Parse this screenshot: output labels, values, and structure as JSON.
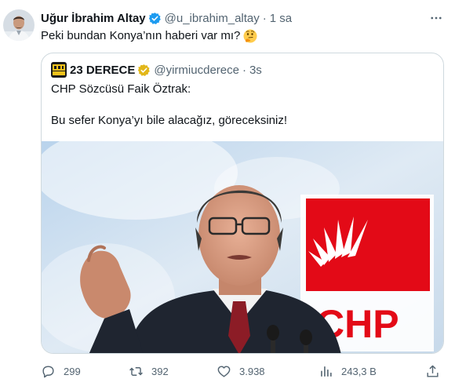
{
  "tweet": {
    "author_name": "Uğur İbrahim Altay",
    "author_handle": "@u_ibrahim_altay",
    "separator": "·",
    "time": "1 sa",
    "text": "Peki bundan Konya’nın haberi var mı?",
    "emoji_icon": "thinking-face-icon"
  },
  "quote": {
    "author_name": "23 DERECE",
    "author_handle": "@yirmiucderece",
    "separator": "·",
    "time": "3s",
    "text_line1": "CHP Sözcüsü Faik Öztrak:",
    "text_line2": "Bu sefer Konya’yı bile alacağız, göreceksiniz!",
    "photo_logo_text": "CHP"
  },
  "actions": {
    "replies": "299",
    "retweets": "392",
    "likes": "3.938",
    "views": "243,3 B"
  },
  "colors": {
    "text_primary": "#0f1419",
    "text_secondary": "#536471",
    "verified_blue": "#1d9bf0",
    "verified_gold": "#e2b719",
    "border": "#cfd9de",
    "chp_red": "#e30a17"
  }
}
